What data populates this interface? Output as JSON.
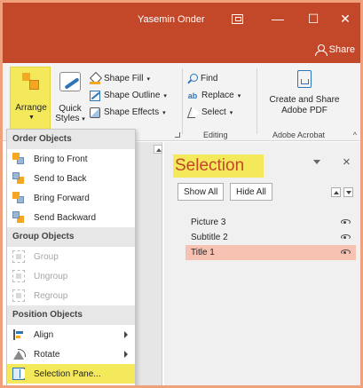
{
  "titlebar": {
    "user": "Yasemin Onder",
    "minimize_glyph": "—",
    "maximize_glyph": "☐",
    "close_glyph": "✕",
    "bg_color": "#c3482a"
  },
  "tabrow": {
    "share_label": "Share"
  },
  "ribbon": {
    "arrange_label": "Arrange",
    "quick_styles_label_1": "Quick",
    "quick_styles_label_2": "Styles",
    "shape_fill": "Shape Fill",
    "shape_outline": "Shape Outline",
    "shape_effects": "Shape Effects",
    "find": "Find",
    "replace": "Replace",
    "select": "Select",
    "editing_group": "Editing",
    "create_share_1": "Create and Share",
    "create_share_2": "Adobe PDF",
    "acrobat_group": "Adobe Acrobat",
    "highlight_color": "#f4e95a"
  },
  "menu": {
    "order_header": "Order Objects",
    "bring_to_front": "Bring to Front",
    "send_to_back": "Send to Back",
    "bring_forward": "Bring Forward",
    "send_backward": "Send Backward",
    "group_header": "Group Objects",
    "group": "Group",
    "ungroup": "Ungroup",
    "regroup": "Regroup",
    "position_header": "Position Objects",
    "align": "Align",
    "rotate": "Rotate",
    "selection_pane": "Selection Pane..."
  },
  "pane": {
    "title": "Selection",
    "show_all": "Show All",
    "hide_all": "Hide All",
    "objects": [
      {
        "name": "Picture 3",
        "selected": false
      },
      {
        "name": "Subtitle 2",
        "selected": false
      },
      {
        "name": "Title 1",
        "selected": true
      }
    ],
    "title_color": "#c3482a",
    "selected_row_color": "#f8c2b2"
  }
}
